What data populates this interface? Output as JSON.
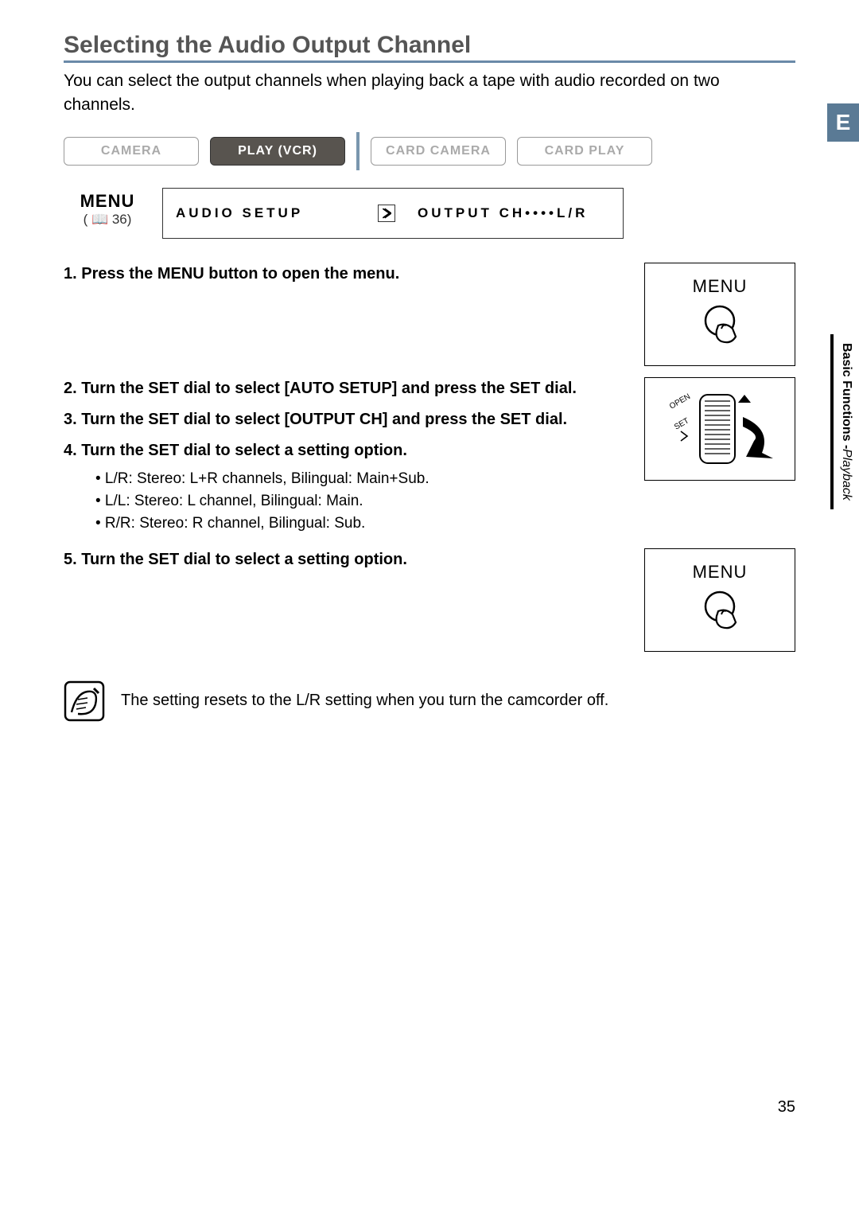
{
  "title": "Selecting the Audio Output Channel",
  "intro": "You can select the output channels when playing back a tape with audio recorded on two channels.",
  "side_tab_e": "E",
  "side_section_bold": "Basic Functions -",
  "side_section_italic": "Playback",
  "modes": {
    "camera": "CAMERA",
    "play_vcr": "PLAY (VCR)",
    "card_camera": "CARD CAMERA",
    "card_play": "CARD PLAY"
  },
  "menu_label": {
    "word": "MENU",
    "ref": "( 📖 36)"
  },
  "menu_path": {
    "seg1": "AUDIO SETUP",
    "seg2": "OUTPUT CH••••L/R"
  },
  "steps": {
    "s1": "1. Press the MENU button to open the menu.",
    "s2": "2. Turn the SET dial to select [AUTO SETUP] and press the SET dial.",
    "s3": "3. Turn the SET dial to select [OUTPUT CH] and press the SET dial.",
    "s4": "4. Turn the SET dial to select a setting option.",
    "s4_opts": [
      "• L/R: Stereo: L+R channels, Bilingual: Main+Sub.",
      "• L/L: Stereo: L channel, Bilingual: Main.",
      "• R/R: Stereo: R channel, Bilingual: Sub."
    ],
    "s5": "5. Turn the SET dial to select a setting option."
  },
  "illus_menu_label": "MENU",
  "note": "The setting resets to the L/R setting when you turn the camcorder off.",
  "page_number": "35"
}
